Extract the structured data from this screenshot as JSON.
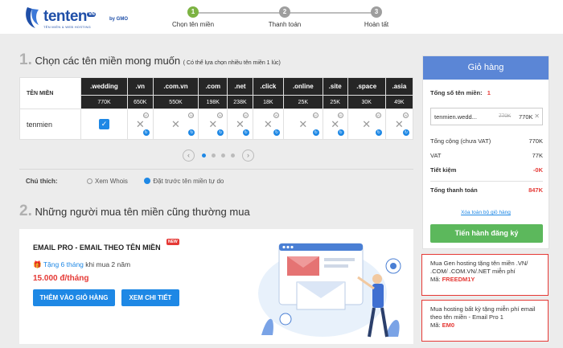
{
  "logo": {
    "word": "tenten",
    "vn": "VN",
    "gmo": "by GMO",
    "tagline": "TÊN MIỀN & WEB HOSTING"
  },
  "steps": [
    {
      "num": "1",
      "label": "Chọn tên miền"
    },
    {
      "num": "2",
      "label": "Thanh toán"
    },
    {
      "num": "3",
      "label": "Hoàn tất"
    }
  ],
  "section1": {
    "num": "1.",
    "title": "Chọn các tên miền mong muốn",
    "note": "( Có thể lựa chọn nhiều tên miền 1 lúc)"
  },
  "table": {
    "label": "TÊN MIỀN",
    "domain": "tenmien",
    "extensions": [
      {
        "ext": ".wedding",
        "price": "770K",
        "selected": true
      },
      {
        "ext": ".vn",
        "price": "650K",
        "selected": false
      },
      {
        "ext": ".com.vn",
        "price": "550K",
        "selected": false
      },
      {
        "ext": ".com",
        "price": "198K",
        "selected": false
      },
      {
        "ext": ".net",
        "price": "238K",
        "selected": false
      },
      {
        "ext": ".click",
        "price": "18K",
        "selected": false
      },
      {
        "ext": ".online",
        "price": "25K",
        "selected": false
      },
      {
        "ext": ".site",
        "price": "25K",
        "selected": false
      },
      {
        "ext": ".space",
        "price": "30K",
        "selected": false
      },
      {
        "ext": ".asia",
        "price": "49K",
        "selected": false
      }
    ],
    "whois_symbol": "W",
    "reserve_symbol": "↻"
  },
  "pager": {
    "prev": "‹",
    "next": "›",
    "active": 0,
    "count": 4
  },
  "legend": {
    "title": "Chú thích:",
    "whois": "Xem Whois",
    "reserve": "Đặt trước tên miền tự do"
  },
  "section2": {
    "num": "2.",
    "title": "Những người mua tên miền cũng thường mua"
  },
  "email_card": {
    "title": "EMAIL PRO - EMAIL THEO TÊN MIỀN",
    "badge": "NEW",
    "promo_prefix": "Tặng 6 tháng",
    "promo_suffix": " khi mua 2 năm",
    "price": "15.000 đ/tháng",
    "add_button": "THÊM VÀO GIỎ HÀNG",
    "detail_button": "XEM CHI TIẾT"
  },
  "cart": {
    "title": "Giỏ hàng",
    "total_domains_label": "Tổng số tên miền:",
    "total_domains": "1",
    "item": {
      "name": "tenmien.wedd...",
      "old_price": "770K",
      "price": "770K",
      "remove": "✕"
    },
    "subtotal_label": "Tổng cộng (chưa VAT)",
    "subtotal": "770K",
    "vat_label": "VAT",
    "vat": "77K",
    "saving_label": "Tiết kiệm",
    "saving": "-0K",
    "total_label": "Tổng thanh toán",
    "total": "847K",
    "clear_link": "Xóa toàn bộ giỏ hàng",
    "checkout_button": "Tiến hành đăng ký"
  },
  "promos": [
    {
      "text": "Mua Gen hosting tặng tên miền .VN/ .COM/ .COM.VN/.NET miễn phí",
      "code_label": "Mã: ",
      "code": "FREEDM1Y"
    },
    {
      "text": "Mua hosting bất kỳ tặng miễn phí email theo tên miền - Email Pro 1",
      "code_label": "Mã: ",
      "code": "EM0"
    }
  ],
  "colors": {
    "accent": "#1e88e5",
    "cart_header": "#5b86d6",
    "checkout": "#5cb85c",
    "step_active": "#7cb342",
    "danger": "#e53935"
  }
}
